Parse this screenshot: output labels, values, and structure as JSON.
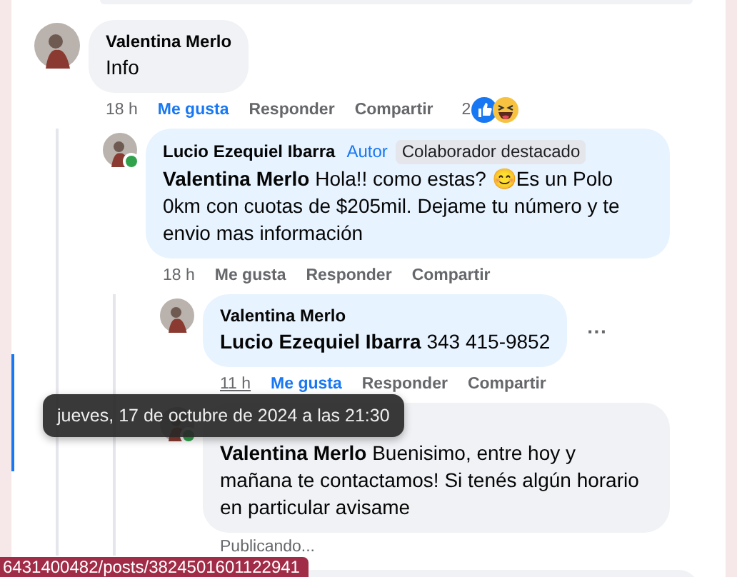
{
  "comments": [
    {
      "author": "Valentina Merlo",
      "online": false,
      "body": "Info",
      "time": "18 h",
      "time_hovered": false,
      "like": "Me gusta",
      "liked": true,
      "reply": "Responder",
      "share": "Compartir",
      "reaction_count": "2",
      "replies": [
        {
          "author": "Lucio Ezequiel Ibarra",
          "author_tag": "Autor",
          "badge": "Colaborador destacado",
          "online": true,
          "body": "**Valentina Merlo** Hola!! como estas? 😊Es un Polo 0km con cuotas de $205mil. Dejame tu número y te envio mas información",
          "time": "18 h",
          "time_hovered": false,
          "like": "Me gusta",
          "liked": false,
          "reply": "Responder",
          "share": "Compartir",
          "replies": [
            {
              "author": "Valentina Merlo",
              "online": false,
              "body": "**Lucio Ezequiel Ibarra** 343 415-9852",
              "more": "···",
              "time": "11 h",
              "time_hovered": true,
              "like": "Me gusta",
              "liked": true,
              "reply": "Responder",
              "share": "Compartir"
            },
            {
              "online": true,
              "body": "**Valentina Merlo** Buenisimo, entre hoy y mañana te contactamos! Si tenés algún horario en particular avisame",
              "status": "Publicando..."
            }
          ]
        }
      ]
    }
  ],
  "tooltip": "jueves, 17 de octubre de 2024 a las 21:30",
  "status_bar": "6431400482/posts/3824501601122941"
}
